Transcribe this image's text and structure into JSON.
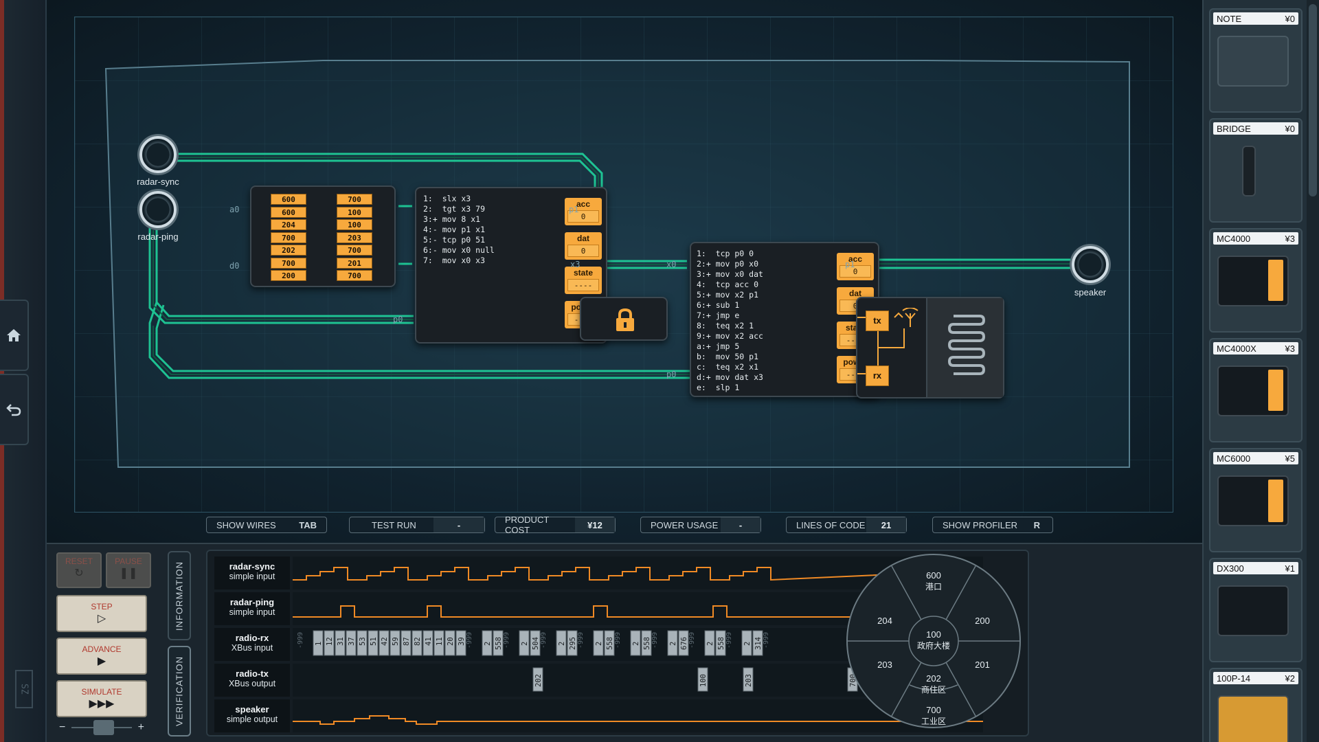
{
  "left_rail": {
    "home_icon": "home-icon",
    "undo_icon": "undo-icon",
    "logo_text": "SZ"
  },
  "board": {
    "inputs": [
      {
        "name": "radar-sync"
      },
      {
        "name": "radar-ping"
      }
    ],
    "output": {
      "name": "speaker"
    },
    "rom": {
      "port_labels": [
        "a0",
        "d0"
      ],
      "col1": [
        "600",
        "600",
        "204",
        "700",
        "202",
        "700",
        "200"
      ],
      "col2": [
        "700",
        "100",
        "100",
        "203",
        "700",
        "201",
        "700"
      ]
    },
    "mc1": {
      "code": "1:  slx x3\n2:  tgt x3 79\n3:+ mov 8 x1\n4:- mov p1 x1\n5:- tcp p0 51\n6:- mov x0 null\n7:  mov x0 x3",
      "registers": [
        {
          "label": "acc",
          "value": "0"
        },
        {
          "label": "dat",
          "value": "0"
        },
        {
          "label": "state",
          "value": "----"
        },
        {
          "label": "power",
          "value": "----"
        }
      ],
      "port_labels": {
        "p1": "p1",
        "x3": "x3",
        "p0": "p0"
      }
    },
    "lock_icon": "lock-icon",
    "mc2": {
      "code": "1:  tcp p0 0\n2:+ mov p0 x0\n3:+ mov x0 dat\n4:  tcp acc 0\n5:+ mov x2 p1\n6:+ sub 1\n7:+ jmp e\n8:  teq x2 1\n9:+ mov x2 acc\na:+ jmp 5\nb:  mov 50 p1\nc:  teq x2 x1\nd:+ mov dat x3\ne:  slp 1",
      "registers": [
        {
          "label": "acc",
          "value": "0"
        },
        {
          "label": "dat",
          "value": "0"
        },
        {
          "label": "state",
          "value": "----"
        },
        {
          "label": "power",
          "value": "----"
        }
      ],
      "port_labels": {
        "x0": "x0",
        "p0": "p0",
        "p1": "p1"
      }
    },
    "radio": {
      "tx_label": "tx",
      "rx_label": "rx",
      "antenna_icon": "antenna-icon",
      "coil_icon": "coil-icon"
    }
  },
  "toolbar": {
    "show_wires": {
      "label": "SHOW WIRES",
      "key": "TAB"
    },
    "test_run": {
      "label": "TEST RUN",
      "value": "-"
    },
    "product_cost": {
      "label": "PRODUCT COST",
      "value": "¥12"
    },
    "power_usage": {
      "label": "POWER USAGE",
      "value": "-"
    },
    "lines_of_code": {
      "label": "LINES OF CODE",
      "value": "21"
    },
    "show_profiler": {
      "label": "SHOW PROFILER",
      "key": "R"
    }
  },
  "controls": {
    "reset": "RESET",
    "pause": "PAUSE",
    "step": "STEP",
    "advance": "ADVANCE",
    "simulate": "SIMULATE",
    "speed_minus": "−",
    "speed_plus": "+"
  },
  "tabs": {
    "information": "INFORMATION",
    "verification": "VERIFICATION"
  },
  "signals": [
    {
      "name": "radar-sync",
      "type": "simple input"
    },
    {
      "name": "radar-ping",
      "type": "simple input"
    },
    {
      "name": "radio-rx",
      "type": "XBus input"
    },
    {
      "name": "radio-tx",
      "type": "XBus output"
    },
    {
      "name": "speaker",
      "type": "simple output"
    }
  ],
  "radio_rx_data": [
    {
      "label": "-999",
      "kind": "null"
    },
    {
      "label": "1",
      "kind": "val"
    },
    {
      "label": "12",
      "kind": "val"
    },
    {
      "label": "31",
      "kind": "val"
    },
    {
      "label": "37",
      "kind": "val"
    },
    {
      "label": "53",
      "kind": "val"
    },
    {
      "label": "51",
      "kind": "val"
    },
    {
      "label": "42",
      "kind": "val"
    },
    {
      "label": "59",
      "kind": "val"
    },
    {
      "label": "87",
      "kind": "val"
    },
    {
      "label": "82",
      "kind": "val"
    },
    {
      "label": "41",
      "kind": "val"
    },
    {
      "label": "11",
      "kind": "val"
    },
    {
      "label": "20",
      "kind": "val"
    },
    {
      "label": "39",
      "kind": "val"
    },
    {
      "label": "-999",
      "kind": "null"
    },
    {
      "label": "2",
      "kind": "val"
    },
    {
      "label": "558",
      "kind": "val"
    },
    {
      "label": "-999",
      "kind": "null"
    },
    {
      "label": "2",
      "kind": "val"
    },
    {
      "label": "504",
      "kind": "val"
    },
    {
      "label": "-999",
      "kind": "null"
    },
    {
      "label": "2",
      "kind": "val"
    },
    {
      "label": "295",
      "kind": "val"
    },
    {
      "label": "-999",
      "kind": "null"
    },
    {
      "label": "2",
      "kind": "val"
    },
    {
      "label": "558",
      "kind": "val"
    },
    {
      "label": "-999",
      "kind": "null"
    },
    {
      "label": "2",
      "kind": "val"
    },
    {
      "label": "558",
      "kind": "val"
    },
    {
      "label": "-999",
      "kind": "null"
    },
    {
      "label": "2",
      "kind": "val"
    },
    {
      "label": "676",
      "kind": "val"
    },
    {
      "label": "-999",
      "kind": "null"
    },
    {
      "label": "2",
      "kind": "val"
    },
    {
      "label": "558",
      "kind": "val"
    },
    {
      "label": "-999",
      "kind": "null"
    },
    {
      "label": "2",
      "kind": "val"
    },
    {
      "label": "314",
      "kind": "val"
    },
    {
      "label": "-999",
      "kind": "null"
    }
  ],
  "radio_tx_data": [
    "202",
    "100",
    "203",
    "700"
  ],
  "dial": {
    "sectors": [
      {
        "num": "600",
        "name": "港口"
      },
      {
        "num": "204",
        "name": ""
      },
      {
        "num": "200",
        "name": ""
      },
      {
        "num": "100",
        "name": "政府大楼"
      },
      {
        "num": "203",
        "name": ""
      },
      {
        "num": "201",
        "name": ""
      },
      {
        "num": "202",
        "name": "商住区"
      },
      {
        "num": "700",
        "name": "工业区"
      }
    ]
  },
  "palette": [
    {
      "name": "NOTE",
      "price": "¥0"
    },
    {
      "name": "BRIDGE",
      "price": "¥0"
    },
    {
      "name": "MC4000",
      "price": "¥3"
    },
    {
      "name": "MC4000X",
      "price": "¥3"
    },
    {
      "name": "MC6000",
      "price": "¥5"
    },
    {
      "name": "DX300",
      "price": "¥1"
    },
    {
      "name": "100P-14",
      "price": "¥2"
    }
  ],
  "colors": {
    "wire": "#1fd39c",
    "signal": "#f08a25",
    "register": "#f7a93d",
    "accent_red": "#b0382d"
  }
}
